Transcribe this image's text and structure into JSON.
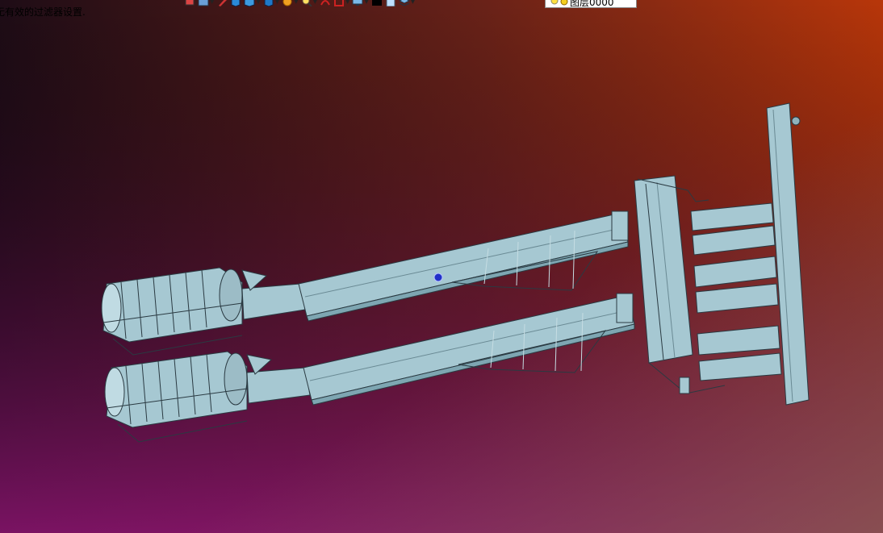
{
  "status_line": "无有效的过滤器设置.",
  "layer_selector": {
    "value": "图层0000"
  },
  "toolbar": {
    "icons": [
      "screen-icon",
      "view-icon",
      "pen-icon",
      "box-icon",
      "solid-icon",
      "cube-icon",
      "sun-icon",
      "zoom-icon",
      "curve-icon",
      "window-icon",
      "display-icon",
      "color-swatch-icon",
      "page-icon",
      "layer-icon"
    ]
  },
  "colors": {
    "bg_top_left": "#1a0a14",
    "bg_top_right": "#b83008",
    "bg_bottom_left": "#7a1060",
    "bg_bottom_right": "#7a5040",
    "model_fill": "#a6c8d2",
    "model_stroke": "#2a3a42",
    "marker": "#2230c8"
  }
}
